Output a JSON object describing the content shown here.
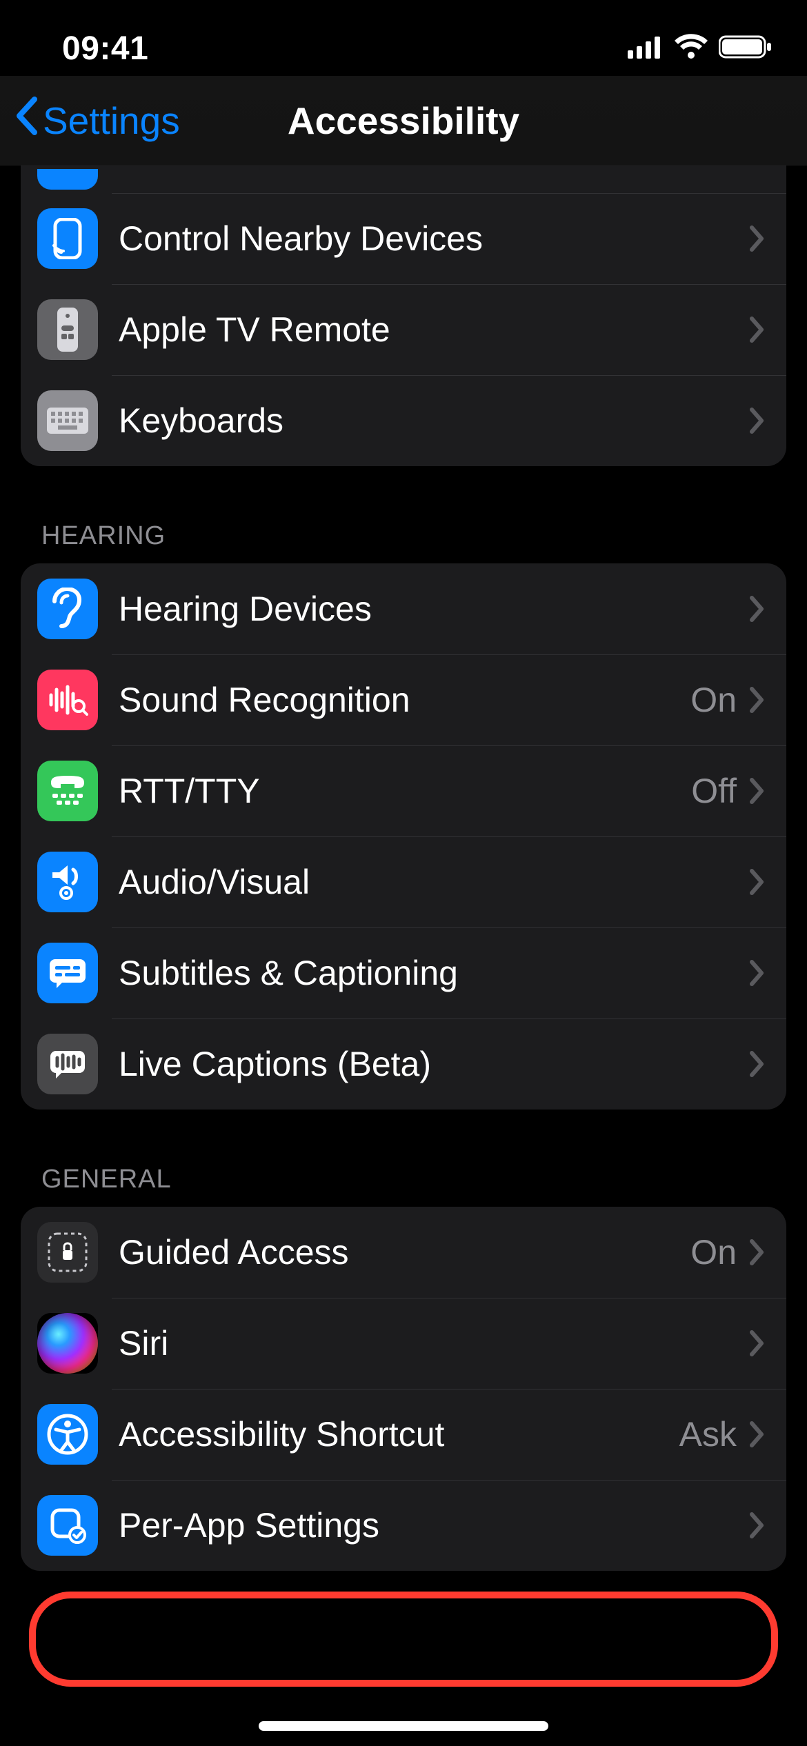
{
  "status": {
    "time": "09:41"
  },
  "nav": {
    "back": "Settings",
    "title": "Accessibility"
  },
  "groups": {
    "physical": {
      "items": [
        {
          "id": "control-nearby",
          "label": "Control Nearby Devices",
          "value": ""
        },
        {
          "id": "apple-tv-remote",
          "label": "Apple TV Remote",
          "value": ""
        },
        {
          "id": "keyboards",
          "label": "Keyboards",
          "value": ""
        }
      ]
    },
    "hearing": {
      "header": "HEARING",
      "items": [
        {
          "id": "hearing-devices",
          "label": "Hearing Devices",
          "value": ""
        },
        {
          "id": "sound-recognition",
          "label": "Sound Recognition",
          "value": "On"
        },
        {
          "id": "rtt-tty",
          "label": "RTT/TTY",
          "value": "Off"
        },
        {
          "id": "audio-visual",
          "label": "Audio/Visual",
          "value": ""
        },
        {
          "id": "subtitles",
          "label": "Subtitles & Captioning",
          "value": ""
        },
        {
          "id": "live-captions",
          "label": "Live Captions (Beta)",
          "value": ""
        }
      ]
    },
    "general": {
      "header": "GENERAL",
      "items": [
        {
          "id": "guided-access",
          "label": "Guided Access",
          "value": "On"
        },
        {
          "id": "siri",
          "label": "Siri",
          "value": ""
        },
        {
          "id": "accessibility-shortcut",
          "label": "Accessibility Shortcut",
          "value": "Ask"
        },
        {
          "id": "per-app-settings",
          "label": "Per-App Settings",
          "value": ""
        }
      ]
    }
  }
}
